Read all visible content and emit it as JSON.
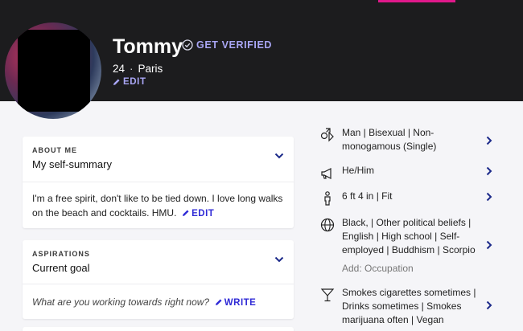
{
  "profile": {
    "name": "Tommy",
    "verify_label": "GET VERIFIED",
    "age": "24",
    "separator": "·",
    "city": "Paris",
    "edit_label": "EDIT"
  },
  "about": {
    "section_label": "ABOUT ME",
    "title": "My self-summary",
    "body": "I'm a free spirit, don't like to be tied down. I love long walks on the beach and cocktails. HMU.",
    "edit_label": "EDIT"
  },
  "aspirations": {
    "section_label": "ASPIRATIONS",
    "title": "Current goal",
    "prompt": "What are you working towards right now?",
    "write_label": "WRITE"
  },
  "details": {
    "identity": "Man | Bisexual | Non-monogamous (Single)",
    "pronouns": "He/Him",
    "body": "6 ft 4 in | Fit",
    "background": "Black, | Other political beliefs | English | High school | Self-employed | Buddhism | Scorpio",
    "add_occupation": "Add: Occupation",
    "habits": "Smokes cigarettes sometimes | Drinks sometimes | Smokes marijuana often | Vegan"
  },
  "colors": {
    "header_bg": "#1c1c1e",
    "accent_pink": "#e0188a",
    "verify_lavender": "#a9a6f5",
    "link_blue": "#2f2ad6",
    "chevron_navy": "#1c2a8a"
  }
}
